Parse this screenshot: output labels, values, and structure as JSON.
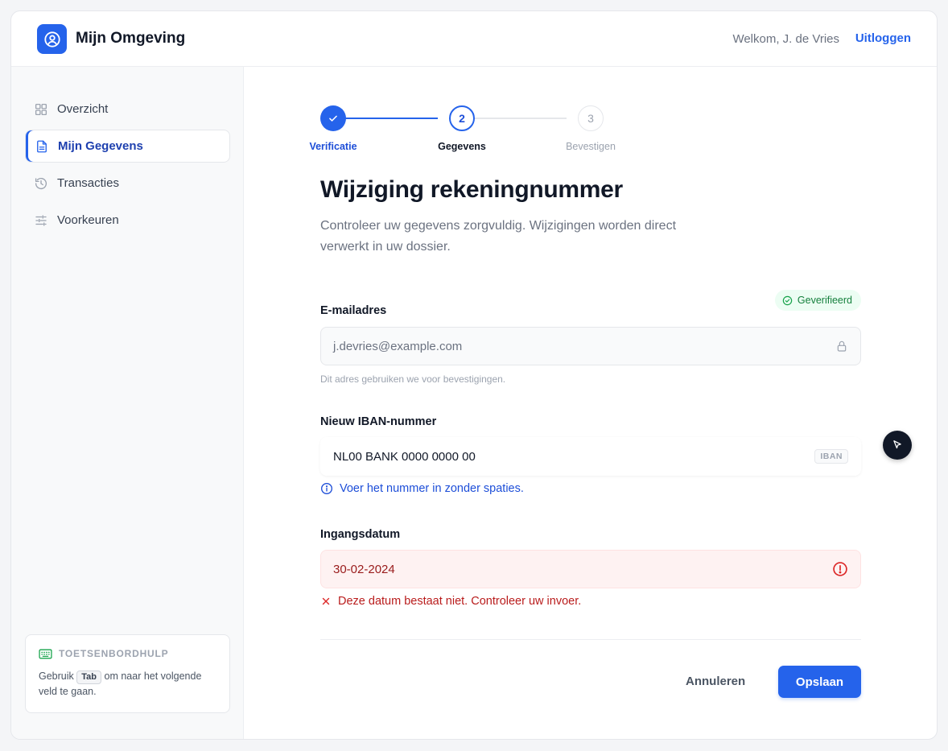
{
  "header": {
    "app_title": "Mijn Omgeving",
    "welcome": "Welkom, J. de Vries",
    "logout": "Uitloggen"
  },
  "sidebar": {
    "items": [
      {
        "label": "Overzicht",
        "icon": "grid-icon",
        "active": false
      },
      {
        "label": "Mijn Gegevens",
        "icon": "document-icon",
        "active": true
      },
      {
        "label": "Transacties",
        "icon": "history-icon",
        "active": false
      },
      {
        "label": "Voorkeuren",
        "icon": "sliders-icon",
        "active": false
      }
    ],
    "help": {
      "title": "TOETSENBORDHULP",
      "text_before": "Gebruik",
      "key": "Tab",
      "text_after": "om naar het volgende veld te gaan."
    }
  },
  "stepper": {
    "steps": [
      {
        "number": "1",
        "label": "Verificatie",
        "state": "done"
      },
      {
        "number": "2",
        "label": "Gegevens",
        "state": "current"
      },
      {
        "number": "3",
        "label": "Bevestigen",
        "state": "upcoming"
      }
    ]
  },
  "form": {
    "title": "Wijziging rekeningnummer",
    "description": "Controleer uw gegevens zorgvuldig. Wijzigingen worden direct verwerkt in uw dossier.",
    "email": {
      "label": "E-mailadres",
      "badge": "Geverifieerd",
      "value": "j.devries@example.com",
      "hint": "Dit adres gebruiken we voor bevestigingen."
    },
    "iban": {
      "label": "Nieuw IBAN-nummer",
      "value": "NL00 BANK 0000 0000 00",
      "tag": "IBAN",
      "info": "Voer het nummer in zonder spaties."
    },
    "date": {
      "label": "Ingangsdatum",
      "value": "30-02-2024",
      "error": "Deze datum bestaat niet. Controleer uw invoer."
    },
    "cancel_label": "Annuleren",
    "save_label": "Opslaan"
  },
  "colors": {
    "accent": "#2563eb",
    "success": "#15803d",
    "error": "#b91c1c",
    "error_bg": "#fef2f2"
  }
}
